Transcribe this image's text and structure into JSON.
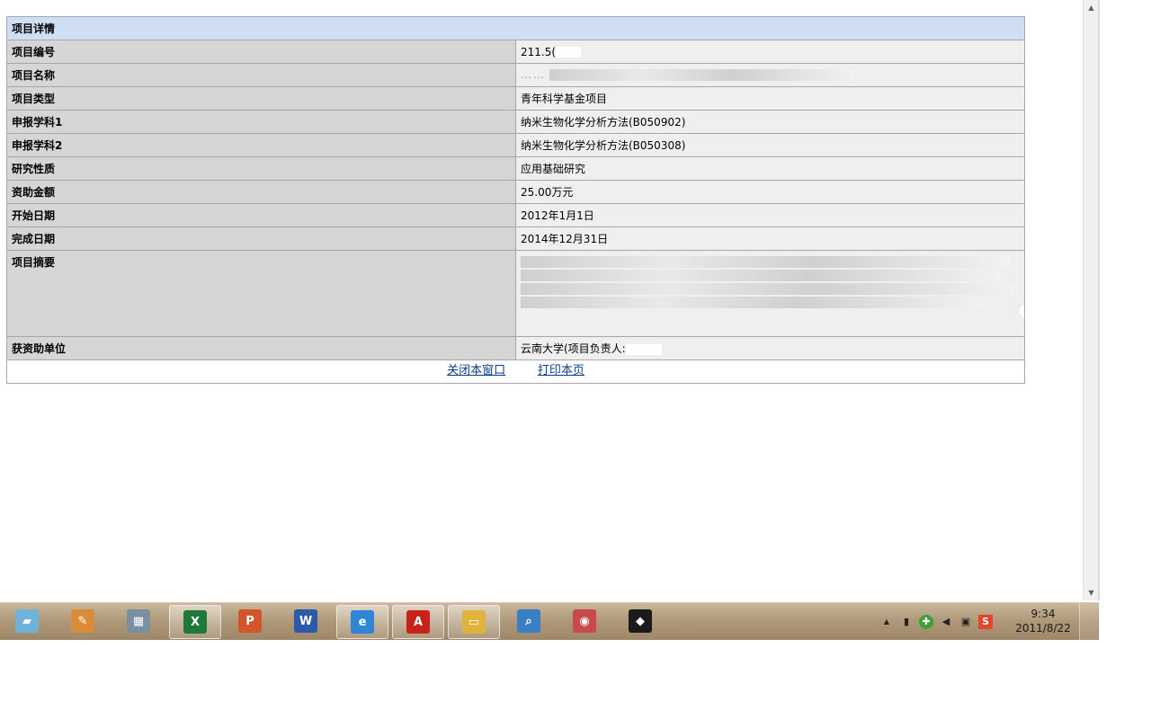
{
  "detail": {
    "header": "项目详情",
    "rows": [
      {
        "label": "项目编号",
        "value": "211.5("
      },
      {
        "label": "项目名称",
        "value": "……"
      },
      {
        "label": "项目类型",
        "value": "青年科学基金项目"
      },
      {
        "label": "申报学科1",
        "value": "纳米生物化学分析方法(B050902)"
      },
      {
        "label": "申报学科2",
        "value": "纳米生物化学分析方法(B050308)"
      },
      {
        "label": "研究性质",
        "value": "应用基础研究"
      },
      {
        "label": "资助金额",
        "value": "25.00万元"
      },
      {
        "label": "开始日期",
        "value": "2012年1月1日"
      },
      {
        "label": "完成日期",
        "value": "2014年12月31日"
      }
    ],
    "abstract_label": "项目摘要",
    "funded_label": "获资助单位",
    "funded_value": "云南大学(项目负责人:"
  },
  "actions": {
    "close": "关闭本窗口",
    "print": "打印本页"
  },
  "taskbar": {
    "apps": [
      {
        "name": "desktop-notes-icon",
        "color": "#6fb4d8",
        "glyph": "▰"
      },
      {
        "name": "paint-icon",
        "color": "#d98c3a",
        "glyph": "✎"
      },
      {
        "name": "calculator-icon",
        "color": "#7b8fa3",
        "glyph": "▦"
      },
      {
        "name": "excel-icon",
        "color": "#1f7a3a",
        "glyph": "X"
      },
      {
        "name": "powerpoint-icon",
        "color": "#d2552b",
        "glyph": "P"
      },
      {
        "name": "word-icon",
        "color": "#2b5aa8",
        "glyph": "W"
      },
      {
        "name": "internet-explorer-icon",
        "color": "#2f86d6",
        "glyph": "e"
      },
      {
        "name": "acrobat-icon",
        "color": "#c9221b",
        "glyph": "A"
      },
      {
        "name": "file-explorer-icon",
        "color": "#e0b43a",
        "glyph": "▭"
      },
      {
        "name": "search-magnifier-icon",
        "color": "#3a7fc4",
        "glyph": "⌕"
      },
      {
        "name": "media-player-icon",
        "color": "#c84a4a",
        "glyph": "◉"
      },
      {
        "name": "app-dark-icon",
        "color": "#1b1b1b",
        "glyph": "◆"
      }
    ],
    "tray": [
      "chevron-up-icon",
      "usb-icon",
      "add-icon",
      "volume-icon",
      "network-icon",
      "sogou-ime-icon"
    ],
    "time": "9:34",
    "date": "2011/8/22"
  }
}
